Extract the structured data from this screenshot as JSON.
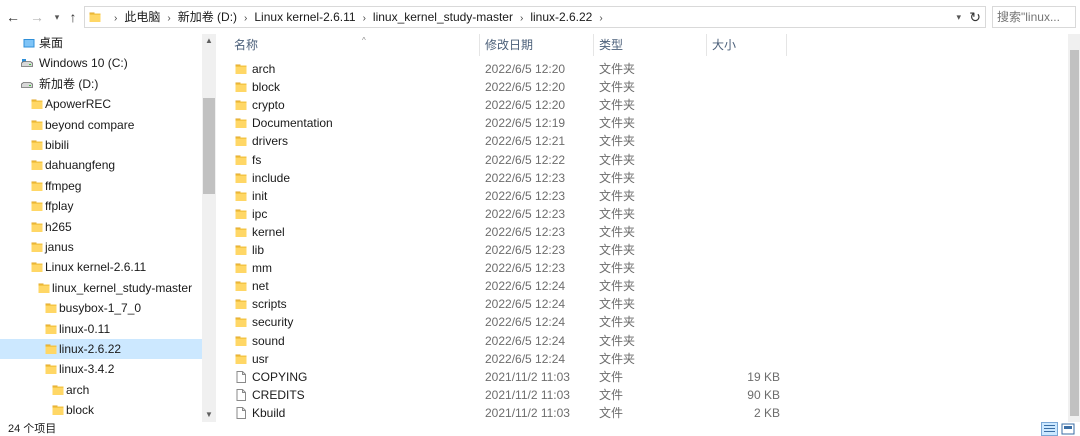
{
  "toolbar": {
    "back_icon": "arrow-left-icon",
    "forward_icon": "arrow-right-icon",
    "recent_icon": "chevron-down-icon",
    "up_icon": "arrow-up-icon"
  },
  "address": {
    "crumbs": [
      "此电脑",
      "新加卷 (D:)",
      "Linux kernel-2.6.11",
      "linux_kernel_study-master",
      "linux-2.6.22"
    ]
  },
  "search": {
    "placeholder": "搜索\"linux..."
  },
  "nav": {
    "items": [
      {
        "label": "桌面",
        "icon": "desktop-folder-icon",
        "indent": 0
      },
      {
        "label": "Windows 10 (C:)",
        "icon": "system-drive-icon",
        "indent": 0
      },
      {
        "label": "新加卷 (D:)",
        "icon": "drive-icon",
        "indent": 0
      },
      {
        "label": "ApowerREC",
        "icon": "folder-icon",
        "indent": 1
      },
      {
        "label": "beyond compare",
        "icon": "folder-icon",
        "indent": 1
      },
      {
        "label": "bibili",
        "icon": "folder-icon",
        "indent": 1
      },
      {
        "label": "dahuangfeng",
        "icon": "folder-icon",
        "indent": 1
      },
      {
        "label": "ffmpeg",
        "icon": "folder-icon",
        "indent": 1
      },
      {
        "label": "ffplay",
        "icon": "folder-icon",
        "indent": 1
      },
      {
        "label": "h265",
        "icon": "folder-icon",
        "indent": 1
      },
      {
        "label": "janus",
        "icon": "folder-icon",
        "indent": 1
      },
      {
        "label": "Linux kernel-2.6.11",
        "icon": "folder-icon",
        "indent": 1
      },
      {
        "label": "linux_kernel_study-master",
        "icon": "folder-icon",
        "indent": 2
      },
      {
        "label": "busybox-1_7_0",
        "icon": "folder-icon",
        "indent": 3
      },
      {
        "label": "linux-0.11",
        "icon": "folder-icon",
        "indent": 3
      },
      {
        "label": "linux-2.6.22",
        "icon": "folder-icon",
        "indent": 3,
        "selected": true
      },
      {
        "label": "linux-3.4.2",
        "icon": "folder-icon",
        "indent": 3
      },
      {
        "label": "arch",
        "icon": "folder-icon",
        "indent": 4
      },
      {
        "label": "block",
        "icon": "folder-icon",
        "indent": 4
      }
    ]
  },
  "columns": {
    "name": "名称",
    "date": "修改日期",
    "type": "类型",
    "size": "大小"
  },
  "files": [
    {
      "name": "arch",
      "date": "2022/6/5 12:20",
      "type": "文件夹",
      "size": "",
      "icon": "folder-icon"
    },
    {
      "name": "block",
      "date": "2022/6/5 12:20",
      "type": "文件夹",
      "size": "",
      "icon": "folder-icon"
    },
    {
      "name": "crypto",
      "date": "2022/6/5 12:20",
      "type": "文件夹",
      "size": "",
      "icon": "folder-icon"
    },
    {
      "name": "Documentation",
      "date": "2022/6/5 12:19",
      "type": "文件夹",
      "size": "",
      "icon": "folder-icon"
    },
    {
      "name": "drivers",
      "date": "2022/6/5 12:21",
      "type": "文件夹",
      "size": "",
      "icon": "folder-icon"
    },
    {
      "name": "fs",
      "date": "2022/6/5 12:22",
      "type": "文件夹",
      "size": "",
      "icon": "folder-icon"
    },
    {
      "name": "include",
      "date": "2022/6/5 12:23",
      "type": "文件夹",
      "size": "",
      "icon": "folder-icon"
    },
    {
      "name": "init",
      "date": "2022/6/5 12:23",
      "type": "文件夹",
      "size": "",
      "icon": "folder-icon"
    },
    {
      "name": "ipc",
      "date": "2022/6/5 12:23",
      "type": "文件夹",
      "size": "",
      "icon": "folder-icon"
    },
    {
      "name": "kernel",
      "date": "2022/6/5 12:23",
      "type": "文件夹",
      "size": "",
      "icon": "folder-icon"
    },
    {
      "name": "lib",
      "date": "2022/6/5 12:23",
      "type": "文件夹",
      "size": "",
      "icon": "folder-icon"
    },
    {
      "name": "mm",
      "date": "2022/6/5 12:23",
      "type": "文件夹",
      "size": "",
      "icon": "folder-icon"
    },
    {
      "name": "net",
      "date": "2022/6/5 12:24",
      "type": "文件夹",
      "size": "",
      "icon": "folder-icon"
    },
    {
      "name": "scripts",
      "date": "2022/6/5 12:24",
      "type": "文件夹",
      "size": "",
      "icon": "folder-icon"
    },
    {
      "name": "security",
      "date": "2022/6/5 12:24",
      "type": "文件夹",
      "size": "",
      "icon": "folder-icon"
    },
    {
      "name": "sound",
      "date": "2022/6/5 12:24",
      "type": "文件夹",
      "size": "",
      "icon": "folder-icon"
    },
    {
      "name": "usr",
      "date": "2022/6/5 12:24",
      "type": "文件夹",
      "size": "",
      "icon": "folder-icon"
    },
    {
      "name": "COPYING",
      "date": "2021/11/2 11:03",
      "type": "文件",
      "size": "19 KB",
      "icon": "file-icon"
    },
    {
      "name": "CREDITS",
      "date": "2021/11/2 11:03",
      "type": "文件",
      "size": "90 KB",
      "icon": "file-icon"
    },
    {
      "name": "Kbuild",
      "date": "2021/11/2 11:03",
      "type": "文件",
      "size": "2 KB",
      "icon": "file-icon"
    }
  ],
  "status": {
    "count": "24 个项目"
  },
  "colors": {
    "accent": "#cce8ff",
    "folder": "#f4c545",
    "header_text": "#4c607a"
  }
}
